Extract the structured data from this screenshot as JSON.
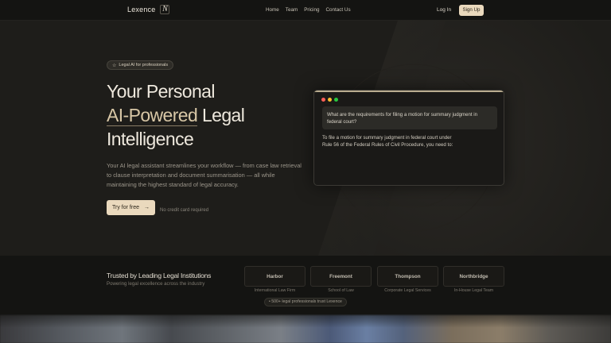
{
  "nav": {
    "brand": "Lexence",
    "logo_glyph": "N",
    "links": [
      "Home",
      "Team",
      "Pricing",
      "Contact Us"
    ],
    "login": "Log In",
    "signup": "Sign Up"
  },
  "hero": {
    "badge_icon": "star-icon",
    "badge_glyph": "☆",
    "badge": "Legal AI for professionals",
    "headline_line1": "Your Personal",
    "headline_highlight": "AI-Powered",
    "headline_line2_rest": " Legal",
    "headline_line3": "Intelligence",
    "description": "Your AI legal assistant streamlines your workflow — from case law retrieval to clause interpretation and document summarisation — all while maintaining the highest standard of legal accuracy.",
    "cta_label": "Try for free",
    "cta_arrow": "→",
    "cta_note": "No credit card required"
  },
  "chat": {
    "dot_colors": [
      "#ff5f57",
      "#febc2e",
      "#28c840"
    ],
    "question": "What are the requirements for filing a motion for summary judgment in federal court?",
    "answer": "To file a motion for summary judgment in federal court under Rule 56 of the Federal Rules of Civil Procedure, you need to:"
  },
  "trust": {
    "title": "Trusted by Leading Legal Institutions",
    "subtitle": "Powering legal excellence across the industry",
    "orgs": [
      {
        "name": "Harbor",
        "caption": "International Law Firm"
      },
      {
        "name": "Freemont",
        "caption": "School of Law"
      },
      {
        "name": "Thompson",
        "caption": "Corporate Legal Services"
      },
      {
        "name": "Northbridge",
        "caption": "In-House Legal Team"
      }
    ],
    "pill": "• 500+ legal professionals trust Lexence"
  },
  "colors": {
    "accent": "#ead9bd",
    "background": "#1e1d1a",
    "highlight_text": "#d8c7a6"
  }
}
